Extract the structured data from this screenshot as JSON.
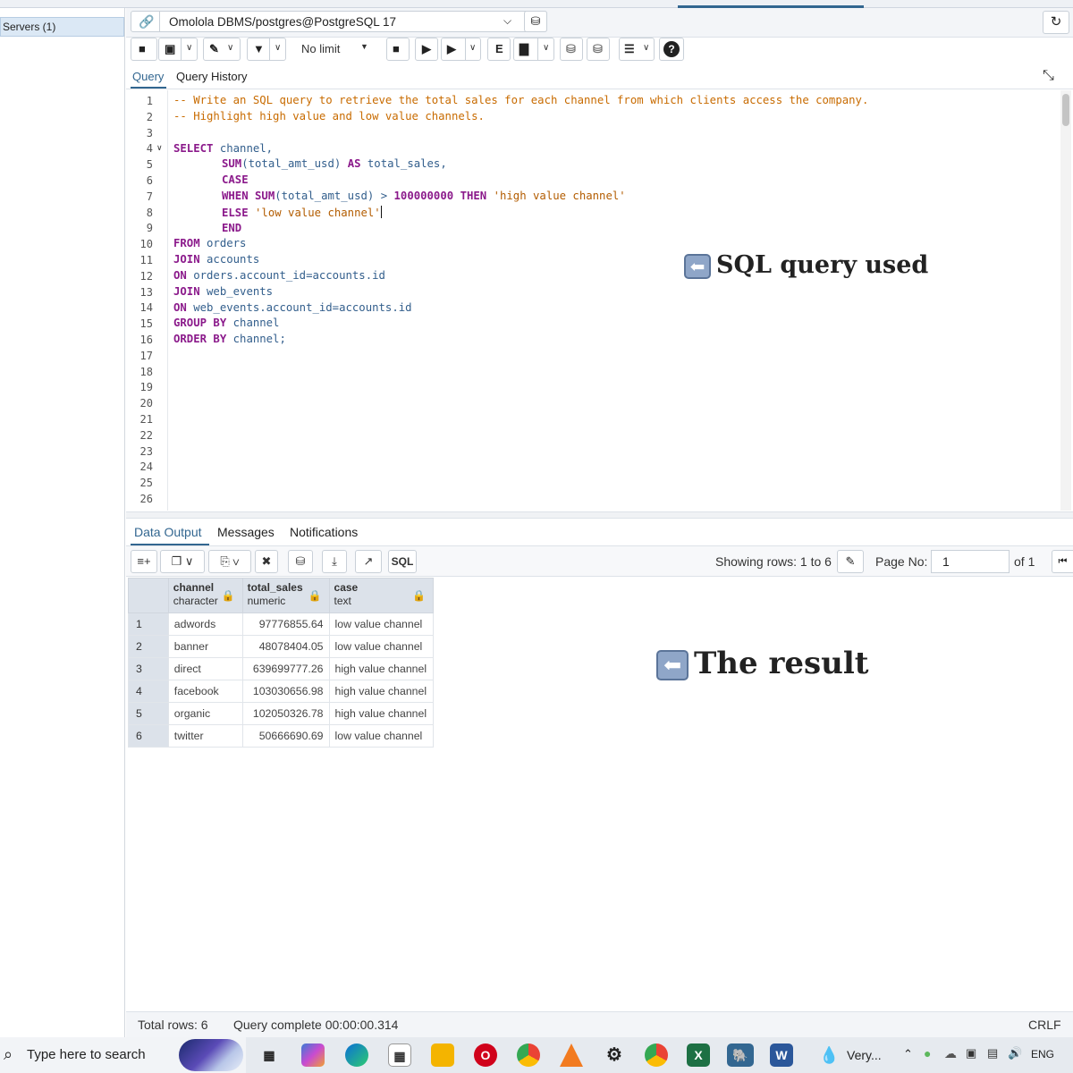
{
  "sidebar": {
    "servers_label": "Servers (1)"
  },
  "connection": {
    "label": "Omolola DBMS/postgres@PostgreSQL 17"
  },
  "toolbar": {
    "limit_label": "No limit"
  },
  "editor_tabs": {
    "query": "Query",
    "history": "Query History"
  },
  "editor": {
    "line_numbers": [
      "1",
      "2",
      "3",
      "4",
      "5",
      "6",
      "7",
      "8",
      "9",
      "10",
      "11",
      "12",
      "13",
      "14",
      "15",
      "16",
      "17",
      "18",
      "19",
      "20",
      "21",
      "22",
      "23",
      "24",
      "25",
      "26"
    ],
    "lines": {
      "l1": "-- Write an SQL query to retrieve the total sales for each channel from which clients access the company.",
      "l2": "-- Highlight high value and low value channels.",
      "l4a": "SELECT",
      "l4b": " channel,",
      "l5a": "SUM",
      "l5b": "(total_amt_usd) ",
      "l5c": "AS",
      "l5d": " total_sales,",
      "l6": "CASE",
      "l7a": "WHEN",
      "l7b": "SUM",
      "l7c": "(total_amt_usd) > ",
      "l7d": "100000000",
      "l7e": "THEN",
      "l7f": "'high value channel'",
      "l8a": "ELSE",
      "l8b": "'low value channel'",
      "l9": "END",
      "l10a": "FROM",
      "l10b": " orders",
      "l11a": "JOIN",
      "l11b": " accounts",
      "l12a": "ON",
      "l12b": " orders.account_id=accounts.id",
      "l13a": "JOIN",
      "l13b": " web_events",
      "l14a": "ON",
      "l14b": " web_events.account_id=accounts.id",
      "l15a": "GROUP BY",
      "l15b": " channel",
      "l16a": "ORDER BY",
      "l16b": " channel;"
    }
  },
  "annotations": {
    "query": "SQL query used",
    "result": "The result"
  },
  "output_tabs": {
    "data": "Data Output",
    "messages": "Messages",
    "notifications": "Notifications"
  },
  "output_toolbar": {
    "sql_label": "SQL",
    "rows_text": "Showing rows: 1 to 6",
    "page_label": "Page No:",
    "page_value": "1",
    "of_text": "of 1"
  },
  "results": {
    "columns": [
      {
        "name": "channel",
        "type": "character"
      },
      {
        "name": "total_sales",
        "type": "numeric"
      },
      {
        "name": "case",
        "type": "text"
      }
    ],
    "rows": [
      {
        "n": "1",
        "channel": "adwords",
        "total_sales": "97776855.64",
        "case": "low value channel"
      },
      {
        "n": "2",
        "channel": "banner",
        "total_sales": "48078404.05",
        "case": "low value channel"
      },
      {
        "n": "3",
        "channel": "direct",
        "total_sales": "639699777.26",
        "case": "high value channel"
      },
      {
        "n": "4",
        "channel": "facebook",
        "total_sales": "103030656.98",
        "case": "high value channel"
      },
      {
        "n": "5",
        "channel": "organic",
        "total_sales": "102050326.78",
        "case": "high value channel"
      },
      {
        "n": "6",
        "channel": "twitter",
        "total_sales": "50666690.69",
        "case": "low value channel"
      }
    ]
  },
  "status": {
    "total_rows": "Total rows: 6",
    "query_complete": "Query complete 00:00:00.314",
    "line_ending": "CRLF"
  },
  "taskbar": {
    "search_placeholder": "Type here to search",
    "tray_app": "Very...",
    "language": "ENG"
  },
  "colors": {
    "accent": "#326690",
    "keyword": "#8b1a8b",
    "comment": "#c86b00",
    "identifier": "#325e8c"
  }
}
